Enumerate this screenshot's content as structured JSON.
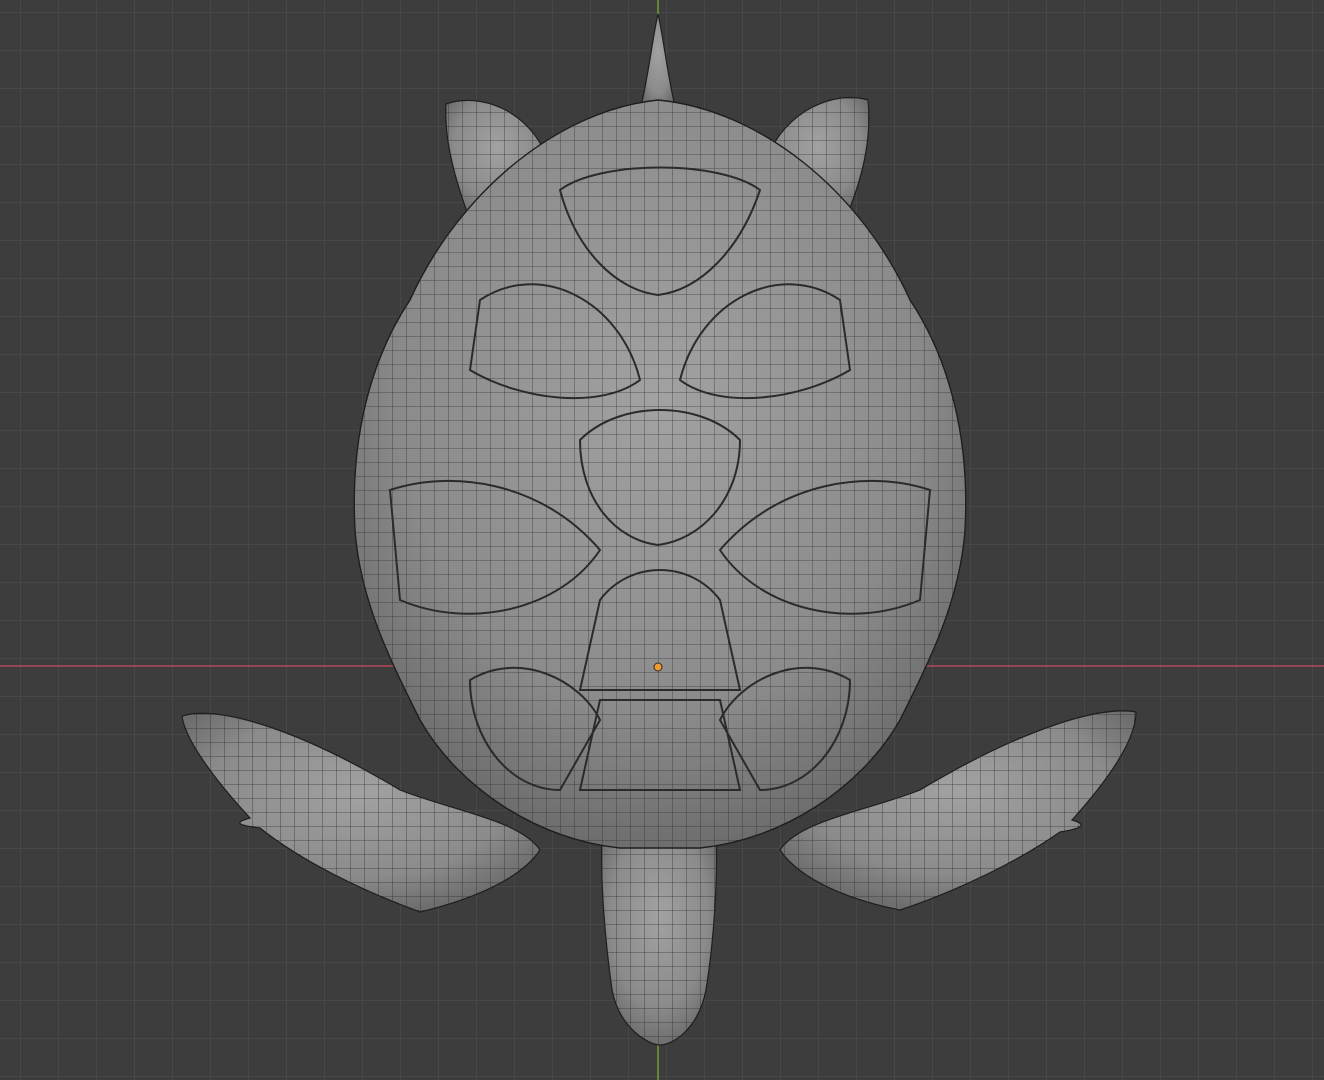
{
  "app": {
    "view": "3D Viewport",
    "shading": "solid-wireframe",
    "object": "turtle-mesh"
  },
  "colors": {
    "background": "#3d3d3d",
    "grid_line": "#484848",
    "x_axis": "#b3495a",
    "y_axis": "#6c9a32",
    "mesh_fill": "#8f8f8f",
    "wire": "#1e1e1e",
    "origin": "#f29a2e"
  }
}
